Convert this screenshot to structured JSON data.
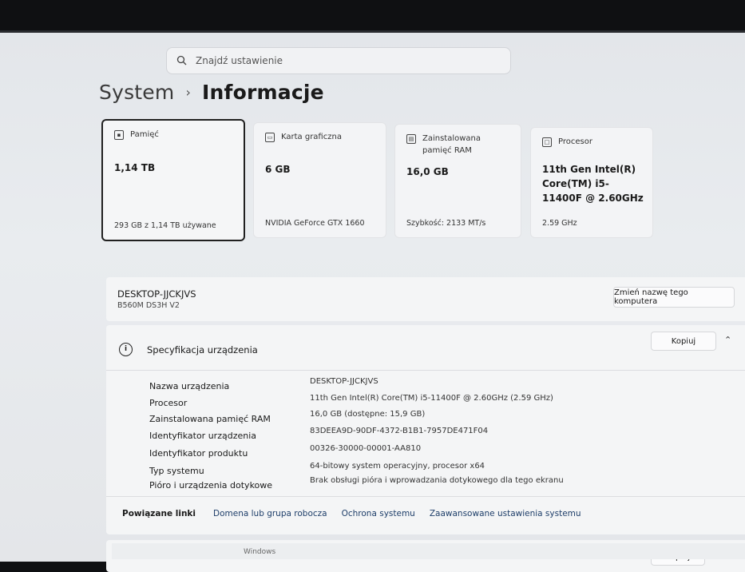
{
  "search": {
    "placeholder": "Znajdź ustawienie"
  },
  "breadcrumb": {
    "parent": "System",
    "separator": "›",
    "current": "Informacje"
  },
  "cards": [
    {
      "name": "Pamięć",
      "value": "1,14 TB",
      "sub": "293 GB z 1,14 TB używane"
    },
    {
      "name": "Karta graficzna",
      "value": "6 GB",
      "sub": "NVIDIA GeForce GTX 1660"
    },
    {
      "name": "Zainstalowana pamięć RAM",
      "value": "16,0 GB",
      "sub": "Szybkość: 2133 MT/s"
    },
    {
      "name": "Procesor",
      "value": "11th Gen Intel(R) Core(TM) i5-11400F @ 2.60GHz",
      "sub": "2.59 GHz"
    }
  ],
  "device": {
    "name": "DESKTOP-JJCKJVS",
    "model": "B560M DS3H V2",
    "rename_label": "Zmień nazwę tego komputera"
  },
  "spec": {
    "title": "Specyfikacja urządzenia",
    "copy_label": "Kopiuj",
    "rows": [
      {
        "key": "Nazwa urządzenia",
        "value": "DESKTOP-JJCKJVS"
      },
      {
        "key": "Procesor",
        "value": "11th Gen Intel(R) Core(TM) i5-11400F @ 2.60GHz (2.59 GHz)"
      },
      {
        "key": "Zainstalowana pamięć RAM",
        "value": "16,0 GB (dostępne: 15,9 GB)"
      },
      {
        "key": "Identyfikator urządzenia",
        "value": "83DEEA9D-90DF-4372-B1B1-7957DE471F04"
      },
      {
        "key": "Identyfikator produktu",
        "value": "00326-30000-00001-AA810"
      },
      {
        "key": "Typ systemu",
        "value": "64-bitowy system operacyjny, procesor x64"
      },
      {
        "key": "Pióro i urządzenia dotykowe",
        "value": "Brak obsługi pióra i wprowadzania dotykowego dla tego ekranu"
      }
    ]
  },
  "related": {
    "title": "Powiązane linki",
    "links": [
      "Domena lub grupa robocza",
      "Ochrona systemu",
      "Zaawansowane ustawienia systemu"
    ]
  },
  "windows": {
    "copy_label": "Kopiuj",
    "label": "Windows"
  },
  "icons": {
    "search": "search-icon",
    "storage": "storage-icon",
    "gpu": "gpu-icon",
    "ram": "ram-icon",
    "cpu": "cpu-icon",
    "info": "info-icon",
    "chevron": "chevron-up-icon"
  }
}
